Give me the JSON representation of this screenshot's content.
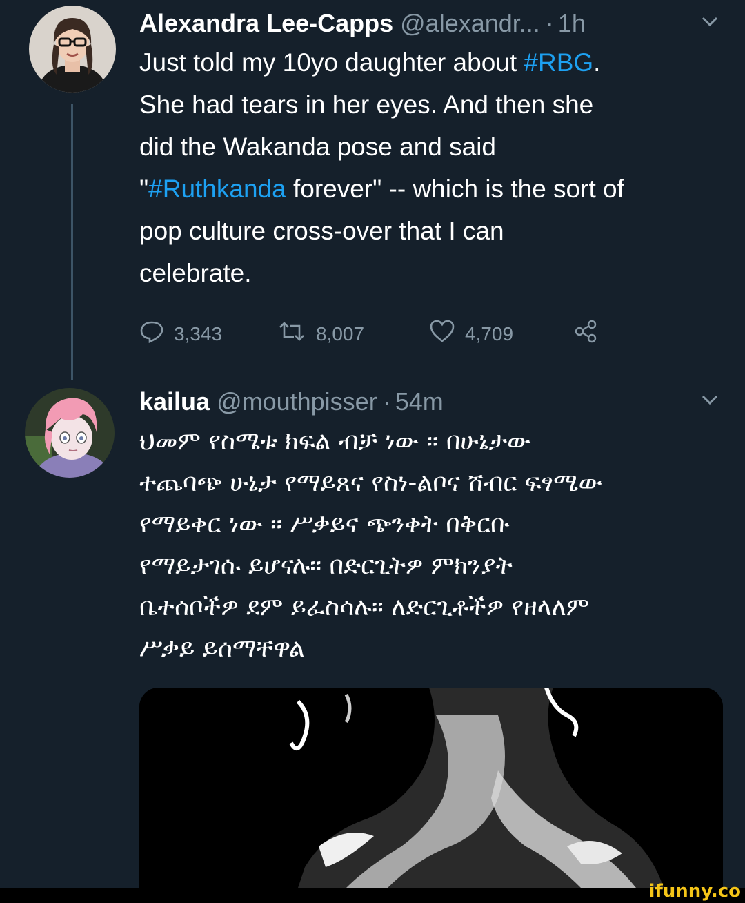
{
  "tweet1": {
    "name": "Alexandra Lee-Capps",
    "handle": "@alexandr...",
    "separator": "·",
    "time": "1h",
    "text_parts": [
      "Just told my 10yo daughter about ",
      "#RBG",
      ".\nShe had tears in her eyes. And then she\ndid the Wakanda pose and said\n\"",
      "#Ruthkanda",
      " forever\" -- which is the sort of\npop culture cross-over that I can\ncelebrate."
    ],
    "replies": "3,343",
    "retweets": "8,007",
    "likes": "4,709"
  },
  "tweet2": {
    "name": "kailua",
    "handle": "@mouthpisser",
    "separator": "·",
    "time": "54m",
    "text": "ህመም የስሜቱ ክፍል ብቻ ነው ። በሁኔታው\nተጨባጭ ሁኔታ የማይጸና የስነ-ልቦና ሸብር ፍፃሜው\nየማይቀር ነው ። ሥቃይና ጭንቀት በቅርቡ\nየማይታገሱ ይሆናሉ። በድርጊትዎ ምክንያት\nቤተሰቦችዎ ደም ይፈስሳሉ። ለድርጊቶችዎ የዘላለም\nሥቃይ ይሰማቸዋል"
  },
  "watermark": "ifunny.co",
  "colors": {
    "background": "#15202b",
    "hashtag": "#1da1f2",
    "muted": "#8899a6"
  },
  "icons": [
    "reply-icon",
    "retweet-icon",
    "like-icon",
    "share-icon",
    "chevron-down-icon"
  ]
}
